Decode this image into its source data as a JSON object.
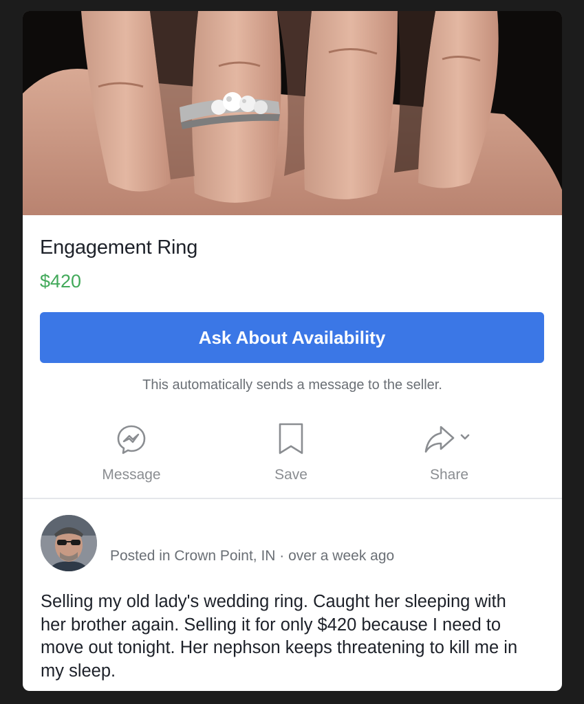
{
  "listing": {
    "title": "Engagement Ring",
    "price": "$420",
    "ask_button_label": "Ask About Availability",
    "ask_note": "This automatically sends a message to the seller."
  },
  "actions": [
    {
      "label": "Message",
      "icon": "messenger-icon"
    },
    {
      "label": "Save",
      "icon": "bookmark-icon"
    },
    {
      "label": "Share",
      "icon": "share-icon"
    }
  ],
  "post": {
    "meta": "Posted in Crown Point, IN · over a week ago",
    "description": "Selling my old lady's wedding ring. Caught her sleeping with her brother again. Selling it for only $420 because I need to move out tonight. Her nephson keeps threatening to kill me in my sleep."
  },
  "colors": {
    "price": "#42a95a",
    "button": "#3b77e6",
    "background": "#1c1c1c"
  }
}
